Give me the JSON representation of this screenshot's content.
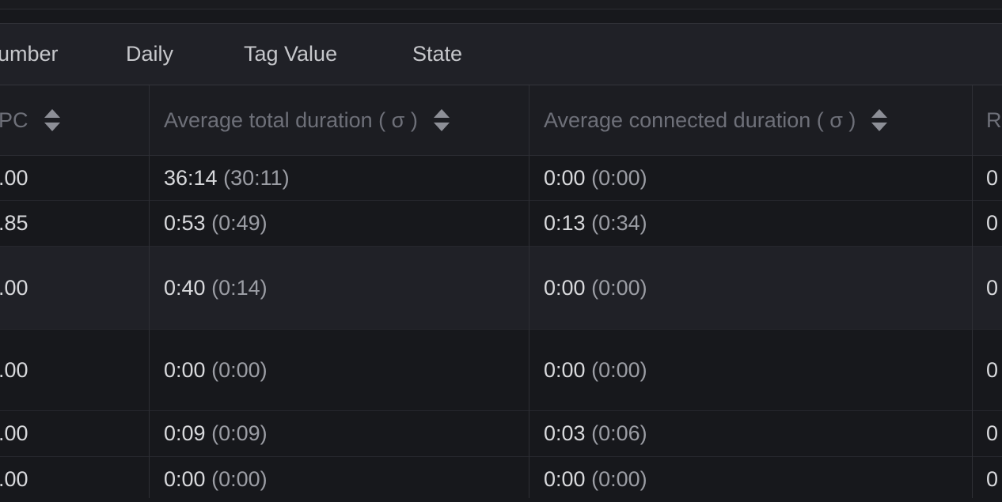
{
  "tabs": [
    {
      "label": "umber"
    },
    {
      "label": "Daily"
    },
    {
      "label": "Tag Value"
    },
    {
      "label": "State"
    }
  ],
  "table": {
    "headers": [
      {
        "label": "PC"
      },
      {
        "label": "Average total duration ( σ )"
      },
      {
        "label": "Average connected duration ( σ )"
      },
      {
        "label": "R"
      }
    ],
    "rows": [
      {
        "c0": ".00",
        "c1": "36:14",
        "c1sd": "(30:11)",
        "c2": "0:00",
        "c2sd": "(0:00)",
        "c3": "0"
      },
      {
        "c0": ".85",
        "c1": "0:53",
        "c1sd": "(0:49)",
        "c2": "0:13",
        "c2sd": "(0:34)",
        "c3": "0"
      },
      {
        "c0": ".00",
        "c1": "0:40",
        "c1sd": "(0:14)",
        "c2": "0:00",
        "c2sd": "(0:00)",
        "c3": "0"
      },
      {
        "c0": ".00",
        "c1": "0:00",
        "c1sd": "(0:00)",
        "c2": "0:00",
        "c2sd": "(0:00)",
        "c3": "0"
      },
      {
        "c0": ".00",
        "c1": "0:09",
        "c1sd": "(0:09)",
        "c2": "0:03",
        "c2sd": "(0:06)",
        "c3": "0"
      },
      {
        "c0": ".00",
        "c1": "0:00",
        "c1sd": "(0:00)",
        "c2": "0:00",
        "c2sd": "(0:00)",
        "c3": "0"
      }
    ]
  }
}
